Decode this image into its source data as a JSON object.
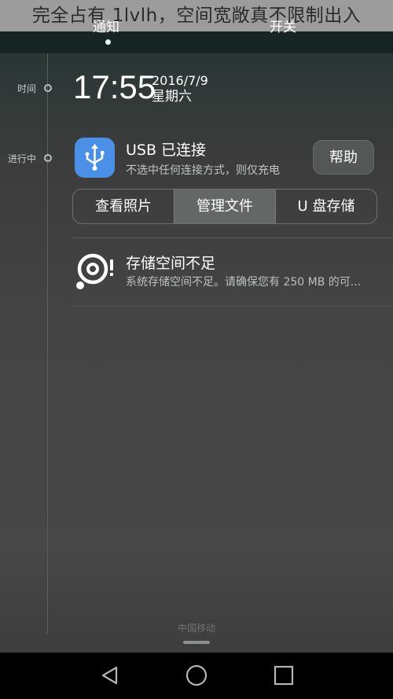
{
  "caption": "完全占有 1lvlh，空间宽敞真不限制出入",
  "header": {
    "tabs": [
      {
        "label": "通知",
        "active": true
      },
      {
        "label": "开关",
        "active": false
      }
    ]
  },
  "timeline": {
    "time_label": "时间",
    "ongoing_label": "进行中"
  },
  "clock": {
    "time": "17:55",
    "date": "2016/7/9",
    "weekday": "星期六"
  },
  "usb_notification": {
    "icon": "usb-icon",
    "icon_color": "#4a90e6",
    "title": "USB 已连接",
    "subtitle": "不选中任何连接方式，则仅充电",
    "help_button": "帮助",
    "options": [
      {
        "label": "查看照片",
        "selected": false
      },
      {
        "label": "管理文件",
        "selected": true
      },
      {
        "label": "U 盘存储",
        "selected": false
      }
    ]
  },
  "storage_notification": {
    "icon": "storage-warning-icon",
    "title": "存储空间不足",
    "subtitle": "系统存储空间不足。请确保您有 250 MB 的可..."
  },
  "carrier": "中国移动",
  "navbar": {
    "back": "back-icon",
    "home": "home-icon",
    "recents": "recents-icon"
  }
}
